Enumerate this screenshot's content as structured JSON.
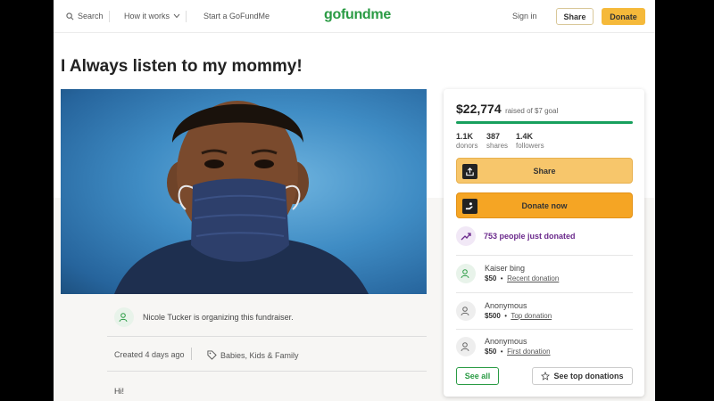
{
  "header": {
    "search_label": "Search",
    "how_it_works_label": "How it works",
    "start_label": "Start a GoFundMe",
    "logo_text": "gofundme",
    "signin_label": "Sign in",
    "share_label": "Share",
    "donate_label": "Donate"
  },
  "campaign": {
    "title": "I Always listen to my mommy!",
    "organizer_text": "Nicole Tucker is organizing this fundraiser.",
    "created_text": "Created 4 days ago",
    "category": "Babies, Kids & Family",
    "story_start": "Hi!"
  },
  "card": {
    "amount": "$22,774",
    "goal_text": "raised of $7 goal",
    "progress_fraction": 1.0,
    "stats": [
      {
        "num": "1.1K",
        "label": "donors"
      },
      {
        "num": "387",
        "label": "shares"
      },
      {
        "num": "1.4K",
        "label": "followers"
      }
    ],
    "share_button": "Share",
    "donate_button": "Donate now",
    "just_donated": "753 people just donated",
    "donations": [
      {
        "name": "Kaiser bing",
        "amount": "$50",
        "tag": "Recent donation"
      },
      {
        "name": "Anonymous",
        "amount": "$500",
        "tag": "Top donation"
      },
      {
        "name": "Anonymous",
        "amount": "$50",
        "tag": "First donation"
      }
    ],
    "see_all": "See all",
    "see_top": "See top donations"
  },
  "colors": {
    "brand_green": "#2a9b44",
    "donate_orange": "#f5a524",
    "share_yellow": "#f7c66b",
    "progress_green": "#17a05d",
    "trend_purple": "#6b2a8c"
  }
}
